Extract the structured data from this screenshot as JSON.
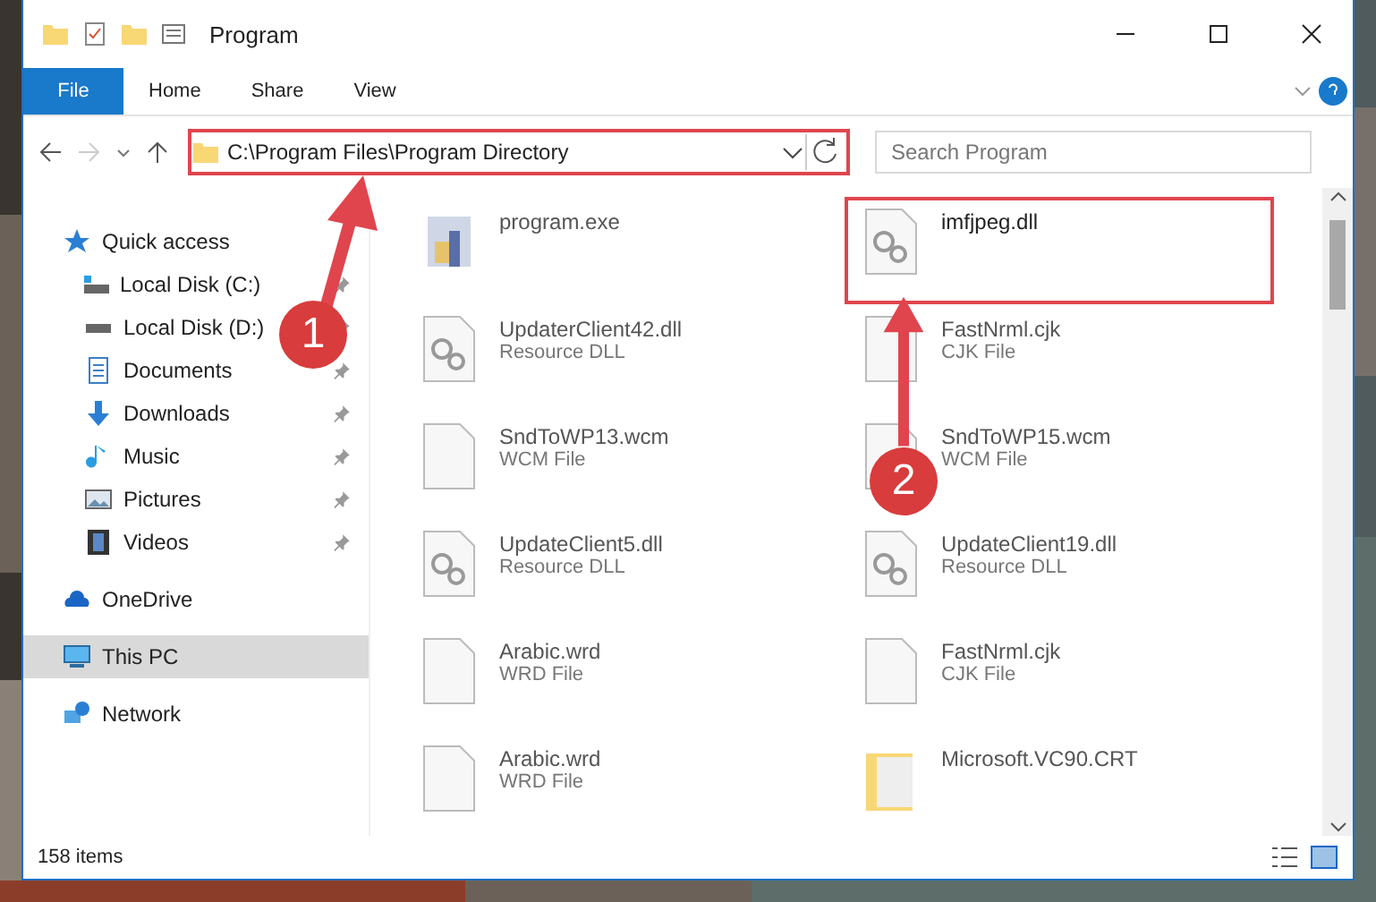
{
  "window": {
    "title": "Program"
  },
  "ribbon_tabs": [
    {
      "label": "File",
      "selected": true
    },
    {
      "label": "Home",
      "selected": false
    },
    {
      "label": "Share",
      "selected": false
    },
    {
      "label": "View",
      "selected": false
    }
  ],
  "address": {
    "path": "C:\\Program Files\\Program Directory",
    "highlighted": true
  },
  "search": {
    "placeholder": "Search Program"
  },
  "sidebar": [
    {
      "label": "Quick access",
      "selected": false,
      "children": [
        {
          "label": "Local Disk (C:)",
          "selected": false,
          "pinned": true
        },
        {
          "label": "Local Disk (D:)",
          "selected": false,
          "pinned": true
        },
        {
          "label": "Documents",
          "selected": false,
          "pinned": true
        },
        {
          "label": "Downloads",
          "selected": false,
          "pinned": true
        },
        {
          "label": "Music",
          "selected": false,
          "pinned": true
        },
        {
          "label": "Pictures",
          "selected": false,
          "pinned": true
        },
        {
          "label": "Videos",
          "selected": false,
          "pinned": true
        }
      ]
    },
    {
      "label": "OneDrive",
      "selected": false
    },
    {
      "label": "This PC",
      "selected": true
    },
    {
      "label": "Network",
      "selected": false
    }
  ],
  "files": [
    {
      "kind": "exe",
      "name": "program.exe",
      "highlighted": false
    },
    {
      "kind": "dll",
      "name": "imfjpeg.dll",
      "highlighted": true
    },
    {
      "kind": "dll",
      "name": "UpdaterClient42.dll",
      "type": "Resource DLL",
      "highlighted": false
    },
    {
      "kind": "file",
      "name": "FastNrml.cjk",
      "type": "CJK File",
      "highlighted": false
    },
    {
      "kind": "file",
      "name": "SndToWP13.wcm",
      "type": "WCM File",
      "highlighted": false
    },
    {
      "kind": "file",
      "name": "SndToWP15.wcm",
      "type": "WCM File",
      "highlighted": false
    },
    {
      "kind": "dll",
      "name": "UpdateClient5.dll",
      "type": "Resource DLL",
      "highlighted": false
    },
    {
      "kind": "dll",
      "name": "UpdateClient19.dll",
      "type": "Resource DLL",
      "highlighted": false
    },
    {
      "kind": "file",
      "name": "Arabic.wrd",
      "type": "WRD File",
      "highlighted": false
    },
    {
      "kind": "file",
      "name": "FastNrml.cjk",
      "type": "CJK File",
      "highlighted": false
    },
    {
      "kind": "file",
      "name": "Arabic.wrd",
      "type": "WRD File",
      "highlighted": false
    },
    {
      "kind": "folder",
      "name": "Microsoft.VC90.CRT",
      "highlighted": false
    }
  ],
  "annotations": [
    {
      "number": "1"
    },
    {
      "number": "2"
    }
  ],
  "status_bar": {
    "count": "158 items"
  }
}
